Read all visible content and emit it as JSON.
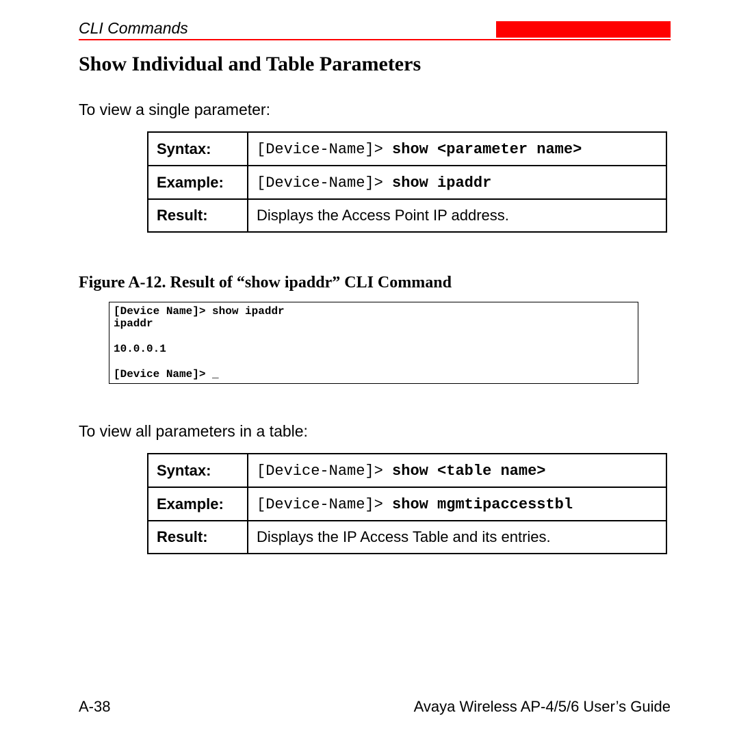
{
  "header": {
    "section": "CLI Commands"
  },
  "title": "Show Individual and Table Parameters",
  "intro1": "To view a single parameter:",
  "table1": {
    "syntax_label": "Syntax:",
    "syntax_prefix": "[Device-Name]>",
    "syntax_cmd": " show <parameter name>",
    "example_label": "Example:",
    "example_prefix": "[Device-Name]>",
    "example_cmd": " show ipaddr",
    "result_label": "Result:",
    "result_text": "Displays the Access Point IP address."
  },
  "figure": {
    "caption": "Figure A-12.   Result of “show ipaddr” CLI Command",
    "output": "[Device Name]> show ipaddr\nipaddr\n\n10.0.0.1\n\n[Device Name]> _"
  },
  "intro2": "To view all parameters in a table:",
  "table2": {
    "syntax_label": "Syntax:",
    "syntax_prefix": "[Device-Name]>",
    "syntax_cmd": " show <table name>",
    "example_label": "Example:",
    "example_prefix": "[Device-Name]>",
    "example_cmd": " show mgmtipaccesstbl",
    "result_label": "Result:",
    "result_text": "Displays the IP Access Table and its entries."
  },
  "footer": {
    "page": "A-38",
    "guide": "Avaya Wireless AP-4/5/6 User’s Guide"
  }
}
